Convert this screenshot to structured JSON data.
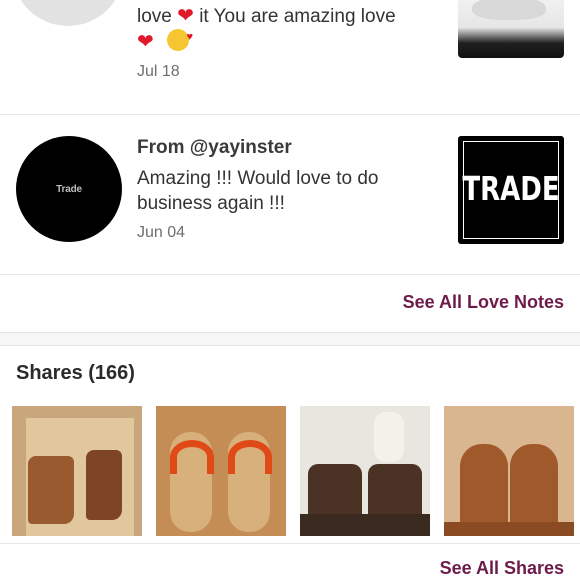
{
  "top_note": {
    "line1_text": "love",
    "line1_rest": "it You are amazing love",
    "date": "Jul 18"
  },
  "yayinster_note": {
    "avatar_text": "Trade",
    "from": "From @yayinster",
    "message_line1": "Amazing !!! Would love to do",
    "message_line2": "business again !!!",
    "date": "Jun 04",
    "thumbnail_text": "TRADE"
  },
  "love_notes": {
    "see_all_label": "See All Love Notes"
  },
  "shares": {
    "title": "Shares (166)",
    "see_all_label": "See All Shares"
  },
  "colors": {
    "link": "#6d1b4b",
    "heart": "#e0192b"
  }
}
